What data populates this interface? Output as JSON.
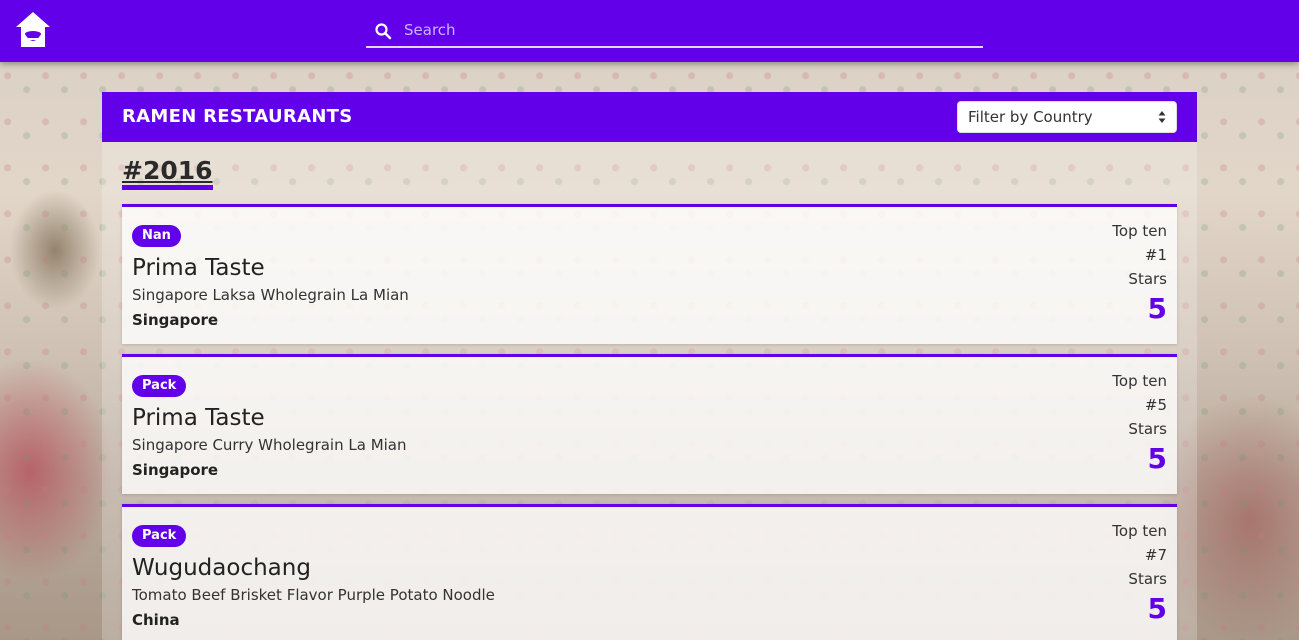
{
  "topbar": {
    "home_icon": "home-icon",
    "search": {
      "placeholder": "Search",
      "value": "",
      "icon": "search-icon"
    }
  },
  "panel": {
    "title": "RAMEN RESTAURANTS",
    "filter": {
      "selected": "Filter by Country",
      "icon": "chevron-updown-icon"
    },
    "year_heading": "#2016",
    "cards": [
      {
        "badge": "Nan",
        "brand": "Prima Taste",
        "variety": "Singapore Laksa Wholegrain La Mian",
        "country": "Singapore",
        "top_ten_label": "Top ten",
        "rank": "#1",
        "stars_label": "Stars",
        "stars": "5"
      },
      {
        "badge": "Pack",
        "brand": "Prima Taste",
        "variety": "Singapore Curry Wholegrain La Mian",
        "country": "Singapore",
        "top_ten_label": "Top ten",
        "rank": "#5",
        "stars_label": "Stars",
        "stars": "5"
      },
      {
        "badge": "Pack",
        "brand": "Wugudaochang",
        "variety": "Tomato Beef Brisket Flavor Purple Potato Noodle",
        "country": "China",
        "top_ten_label": "Top ten",
        "rank": "#7",
        "stars_label": "Stars",
        "stars": "5"
      }
    ]
  },
  "colors": {
    "accent": "#6200ea",
    "search_underline": "#e4d6ff"
  }
}
